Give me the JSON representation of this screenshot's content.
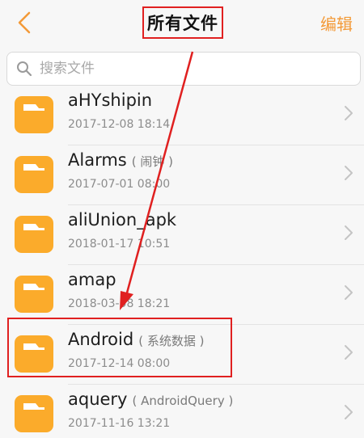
{
  "header": {
    "title": "所有文件",
    "edit_label": "编辑",
    "back_icon": "chevron-left-icon",
    "accent_color": "#f39a38"
  },
  "search": {
    "placeholder": "搜索文件",
    "value": ""
  },
  "files": [
    {
      "name": "aHYshipin",
      "alias": "",
      "date": "2017-12-08 18:14"
    },
    {
      "name": "Alarms",
      "alias": "( 闹钟 )",
      "date": "2017-07-01 08:00"
    },
    {
      "name": "aliUnion_apk",
      "alias": "",
      "date": "2018-01-17 10:51"
    },
    {
      "name": "amap",
      "alias": "",
      "date": "2018-03-08 18:21"
    },
    {
      "name": "Android",
      "alias": "( 系统数据 )",
      "date": "2017-12-14 08:00"
    },
    {
      "name": "aquery",
      "alias": "( AndroidQuery )",
      "date": "2017-11-16 13:21"
    }
  ],
  "annotations": {
    "highlight_color": "#e02020"
  }
}
